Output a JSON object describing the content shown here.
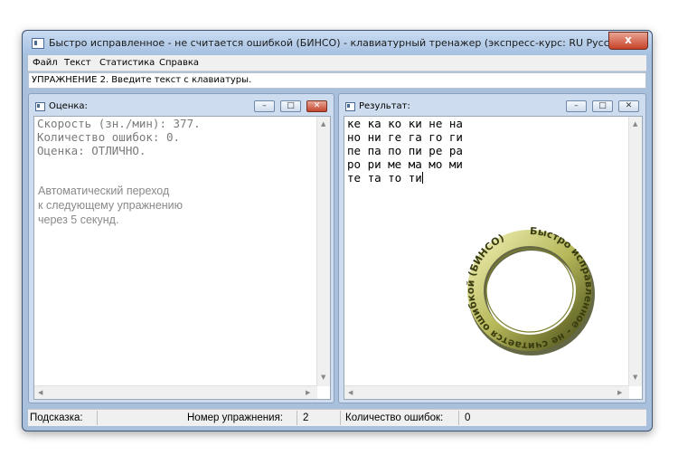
{
  "window": {
    "title": "Быстро исправленное - не считается ошибкой (БИНСО) - клавиатурный тренажер (экспресс-курс: RU Русский)",
    "close_label": "x"
  },
  "menu": [
    "Файл",
    "Текст",
    "Статистика",
    "Справка"
  ],
  "exercise_header": "УПРАЖНЕНИЕ 2. Введите текст с клавиатуры.",
  "score_pane": {
    "title": "Оценка:",
    "lines": [
      "Скорость (зн./мин): 377.",
      "Количество ошибок: 0.",
      "Оценка: ОТЛИЧНО."
    ],
    "auto_lines": [
      "Автоматический переход",
      "к следующему упражнению",
      "через 5 секунд."
    ]
  },
  "result_pane": {
    "title": "Результат:",
    "lines": [
      "ке ка ко ки не на",
      "но ни ге га го ги",
      "пе па по пи ре ра",
      "ро ри ме ма мо ми",
      "те та то ти"
    ],
    "ring_text": "Быстро исправленное - не считается ошибкой (БИНСО)"
  },
  "status": {
    "hint_label": "Подсказка:",
    "exercise_label": "Номер упражнения:",
    "exercise_value": "2",
    "errors_label": "Количество ошибок:",
    "errors_value": "0"
  },
  "colors": {
    "title_bar": "#a7c2e2",
    "close": "#c8432a",
    "ring_light": "#e8e6a0",
    "ring_dark": "#5a5e1e"
  },
  "icons": [
    "app-icon",
    "pane-icon",
    "minimize-icon",
    "maximize-icon",
    "close-icon"
  ]
}
